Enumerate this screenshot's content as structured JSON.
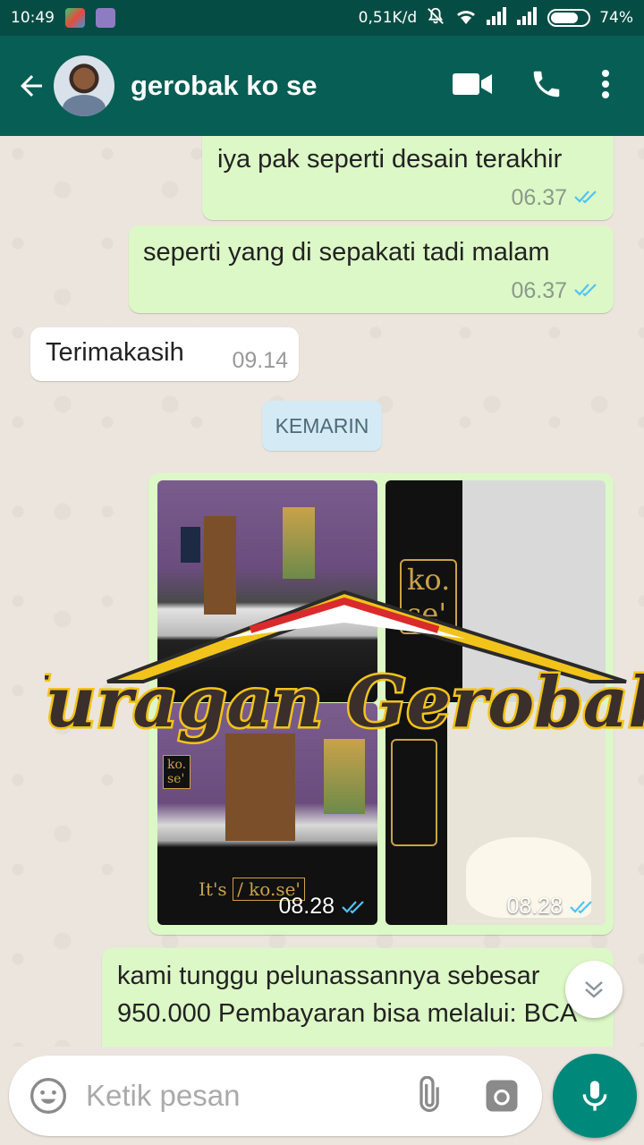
{
  "status_bar": {
    "time": "10:49",
    "speed": "0,51K/d",
    "battery": "74%",
    "battery_level": 0.74
  },
  "header": {
    "contact_name": "gerobak ko se",
    "icons": [
      "back-arrow-icon",
      "video-call-icon",
      "phone-icon",
      "more-vert-icon"
    ]
  },
  "messages": [
    {
      "direction": "out",
      "text": "iya pak seperti desain terakhir",
      "time": "06.37",
      "status": "read"
    },
    {
      "direction": "out",
      "text": "seperti yang di sepakati tadi malam",
      "time": "06.37",
      "status": "read"
    },
    {
      "direction": "in",
      "text": "Terimakasih",
      "time": "09.14"
    },
    {
      "type": "date",
      "text": "KEMARIN"
    },
    {
      "direction": "out",
      "type": "photos",
      "photo_times": [
        "08.28",
        "08.28"
      ],
      "status": "read"
    },
    {
      "direction": "out",
      "text": "kami tunggu pelunassannya sebesar 950.000 Pembayaran bisa melalui: BCA"
    }
  ],
  "photo_text": {
    "logo_line1": "ko.",
    "logo_line2": "se'",
    "sign_text": "/ ko.se'",
    "sign_prefix": "It's"
  },
  "watermark": "Juragan Gerobak",
  "input": {
    "placeholder": "Ketik pesan"
  },
  "colors": {
    "status_bar": "#054d44",
    "app_bar": "#075e54",
    "outgoing_bubble": "#dcf8c6",
    "incoming_bubble": "#ffffff",
    "read_ticks": "#4fc3f7",
    "mic_button": "#00897b",
    "date_chip": "#d4eaf4"
  }
}
